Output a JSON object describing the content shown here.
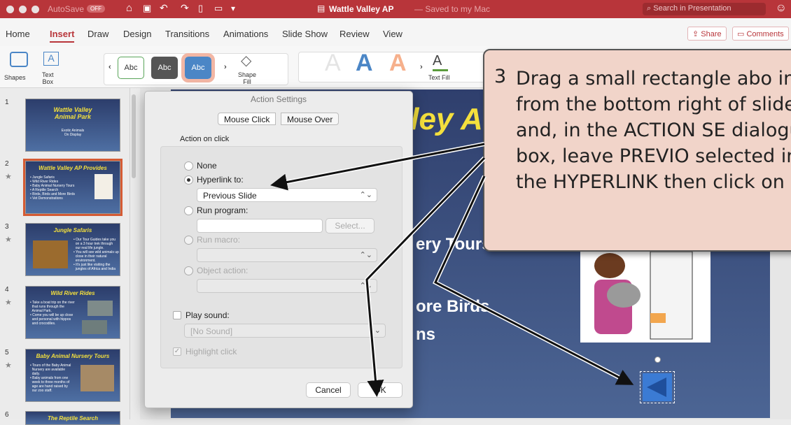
{
  "titlebar": {
    "autosave": "AutoSave",
    "autosave_state": "OFF",
    "doc_title": "Wattle Valley AP",
    "saved_status": "— Saved to my Mac",
    "search_placeholder": "Search in Presentation"
  },
  "menu": {
    "tabs": [
      "Home",
      "Insert",
      "Draw",
      "Design",
      "Transitions",
      "Animations",
      "Slide Show",
      "Review",
      "View"
    ],
    "active_tab": "Insert",
    "share": "Share",
    "comments": "Comments"
  },
  "ribbon": {
    "shapes": "Shapes",
    "text_box": "Text\nBox",
    "styles": [
      "Abc",
      "Abc",
      "Abc"
    ],
    "shape_fill": "Shape\nFill",
    "text_fill": "Text Fill"
  },
  "thumbnails": [
    {
      "num": "1",
      "title": "Wattle Valley\nAnimal Park",
      "sub": "Exotic Animals\nOn Display",
      "star": ""
    },
    {
      "num": "2",
      "title": "Wattle Valley AP Provides",
      "sub": "• Jungle Safaris\n• Wild River Rides\n• Baby Animal Nursery Tours\n• A Reptile Search\n• Birds, Birds and More Birds\n• Vet Demonstrations",
      "star": "★"
    },
    {
      "num": "3",
      "title": "Jungle Safaris",
      "sub": "• Our Tour Guides take you\n  on a 3 hour trek through\n  our real life jungle.\n• You will see wild animals up\n  close in their natural\n  environment.\n• It's just like visiting the\n  jungles of Africa and India",
      "star": "★"
    },
    {
      "num": "4",
      "title": "Wild River Rides",
      "sub": "• Take a boat trip on the river\n  that runs through the\n  Animal Park.\n• Come you will be up close\n  and personal with hippos\n  and crocodiles.",
      "star": "★"
    },
    {
      "num": "5",
      "title": "Baby Animal Nursery Tours",
      "sub": "• Tours of the Baby Animal\n  Nursery are available\n  daily.\n• Baby animals from one\n  week to three months of\n  age are hand raised by\n  our zoo staff.",
      "star": "★"
    },
    {
      "num": "6",
      "title": "The Reptile Search",
      "sub": "",
      "star": ""
    }
  ],
  "slide": {
    "title_fragment": "lley A",
    "bullet_1": "ery Tours",
    "bullet_2": "ore Birds",
    "bullet_3": "ns"
  },
  "dialog": {
    "title": "Action Settings",
    "tab_click": "Mouse Click",
    "tab_over": "Mouse Over",
    "section": "Action on click",
    "none": "None",
    "hyperlink": "Hyperlink to:",
    "hyperlink_value": "Previous Slide",
    "run_program": "Run program:",
    "select_btn": "Select...",
    "run_macro": "Run macro:",
    "object_action": "Object action:",
    "play_sound": "Play sound:",
    "sound_value": "[No Sound]",
    "highlight": "Highlight click",
    "cancel": "Cancel",
    "ok": "OK"
  },
  "callout": {
    "number": "3",
    "text": "Drag a small rectangle abo in from the bottom right of slide and, in the ACTION SE dialogue box, leave PREVIO selected in the HYPERLINK then click on OK."
  }
}
